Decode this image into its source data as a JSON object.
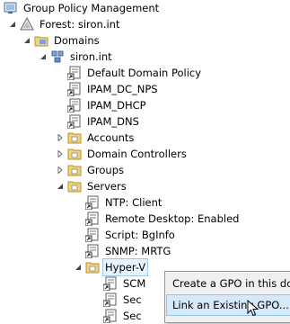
{
  "tree": {
    "root": "Group Policy Management",
    "forest": "Forest: siron.int",
    "domains": "Domains",
    "domain": "siron.int",
    "items": {
      "default_policy": "Default Domain Policy",
      "ipam_dc_nps": "IPAM_DC_NPS",
      "ipam_dhcp": "IPAM_DHCP",
      "ipam_dns": "IPAM_DNS",
      "accounts": "Accounts",
      "domain_controllers": "Domain Controllers",
      "groups": "Groups",
      "servers": "Servers"
    },
    "servers_children": {
      "ntp": "NTP: Client",
      "rdp": "Remote Desktop: Enabled",
      "script": "Script: BgInfo",
      "snmp": "SNMP: MRTG",
      "hyperv": "Hyper-V"
    },
    "hyperv_children": {
      "c1": "SCM",
      "c2": "Sec",
      "c3": "Sec"
    }
  },
  "context_menu": {
    "create_gpo": "Create a GPO in this dom",
    "link_gpo": "Link an Existing GPO..."
  },
  "icons": {
    "console": "gpmc-console-icon",
    "forest": "forest-icon",
    "domains": "domains-folder-icon",
    "domain": "domain-icon",
    "gpo_link": "gpo-link-icon",
    "ou": "ou-folder-icon",
    "cursor": "mouse-cursor-icon"
  }
}
